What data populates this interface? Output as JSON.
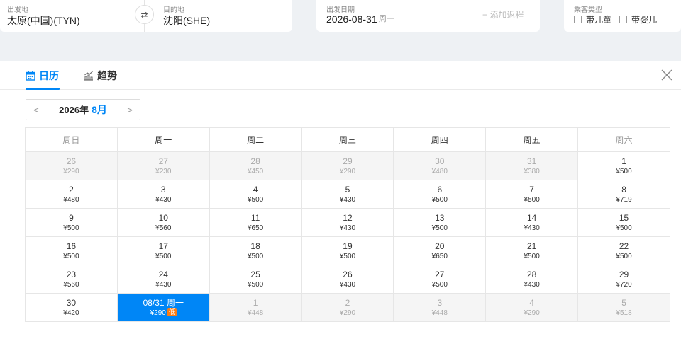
{
  "search": {
    "departure_label": "出发地",
    "departure_value": "太原(中国)(TYN)",
    "destination_label": "目的地",
    "destination_value": "沈阳(SHE)",
    "date_label": "出发日期",
    "date_value": "2026-08-31",
    "date_weekday": "周一",
    "add_return": "+ 添加返程",
    "pax_label": "乘客类型",
    "child_label": "带儿童",
    "infant_label": "带婴儿"
  },
  "tabs": {
    "calendar": "日历",
    "trend": "趋势"
  },
  "month_nav": {
    "year": "2026年",
    "month": "8月",
    "prev": "<",
    "next": ">"
  },
  "weekdays": [
    "周日",
    "周一",
    "周二",
    "周三",
    "周四",
    "周五",
    "周六"
  ],
  "weeks": [
    [
      {
        "day": "26",
        "price": "¥290",
        "state": "off"
      },
      {
        "day": "27",
        "price": "¥230",
        "state": "off"
      },
      {
        "day": "28",
        "price": "¥450",
        "state": "off"
      },
      {
        "day": "29",
        "price": "¥290",
        "state": "off"
      },
      {
        "day": "30",
        "price": "¥480",
        "state": "off"
      },
      {
        "day": "31",
        "price": "¥380",
        "state": "off"
      },
      {
        "day": "1",
        "price": "¥500",
        "state": "on"
      }
    ],
    [
      {
        "day": "2",
        "price": "¥480",
        "state": "on"
      },
      {
        "day": "3",
        "price": "¥430",
        "state": "on"
      },
      {
        "day": "4",
        "price": "¥500",
        "state": "on"
      },
      {
        "day": "5",
        "price": "¥430",
        "state": "on"
      },
      {
        "day": "6",
        "price": "¥500",
        "state": "on"
      },
      {
        "day": "7",
        "price": "¥500",
        "state": "on"
      },
      {
        "day": "8",
        "price": "¥719",
        "state": "on"
      }
    ],
    [
      {
        "day": "9",
        "price": "¥500",
        "state": "on"
      },
      {
        "day": "10",
        "price": "¥560",
        "state": "on"
      },
      {
        "day": "11",
        "price": "¥650",
        "state": "on"
      },
      {
        "day": "12",
        "price": "¥430",
        "state": "on"
      },
      {
        "day": "13",
        "price": "¥500",
        "state": "on"
      },
      {
        "day": "14",
        "price": "¥430",
        "state": "on"
      },
      {
        "day": "15",
        "price": "¥500",
        "state": "on"
      }
    ],
    [
      {
        "day": "16",
        "price": "¥500",
        "state": "on"
      },
      {
        "day": "17",
        "price": "¥500",
        "state": "on"
      },
      {
        "day": "18",
        "price": "¥500",
        "state": "on"
      },
      {
        "day": "19",
        "price": "¥500",
        "state": "on"
      },
      {
        "day": "20",
        "price": "¥650",
        "state": "on"
      },
      {
        "day": "21",
        "price": "¥500",
        "state": "on"
      },
      {
        "day": "22",
        "price": "¥500",
        "state": "on"
      }
    ],
    [
      {
        "day": "23",
        "price": "¥560",
        "state": "on"
      },
      {
        "day": "24",
        "price": "¥430",
        "state": "on"
      },
      {
        "day": "25",
        "price": "¥500",
        "state": "on"
      },
      {
        "day": "26",
        "price": "¥430",
        "state": "on"
      },
      {
        "day": "27",
        "price": "¥500",
        "state": "on"
      },
      {
        "day": "28",
        "price": "¥430",
        "state": "on"
      },
      {
        "day": "29",
        "price": "¥720",
        "state": "on"
      }
    ],
    [
      {
        "day": "30",
        "price": "¥420",
        "state": "on"
      },
      {
        "day": "08/31 周一",
        "price": "¥290",
        "state": "sel",
        "badge": "低"
      },
      {
        "day": "1",
        "price": "¥448",
        "state": "off"
      },
      {
        "day": "2",
        "price": "¥290",
        "state": "off"
      },
      {
        "day": "3",
        "price": "¥448",
        "state": "off"
      },
      {
        "day": "4",
        "price": "¥290",
        "state": "off"
      },
      {
        "day": "5",
        "price": "¥518",
        "state": "off"
      }
    ]
  ],
  "colors": {
    "accent": "#0086f6",
    "low_badge": "#ff7d13"
  },
  "icons": {
    "calendar": "calendar-icon",
    "trend": "trend-chart-icon",
    "swap": "swap-icon",
    "close": "close-icon"
  }
}
